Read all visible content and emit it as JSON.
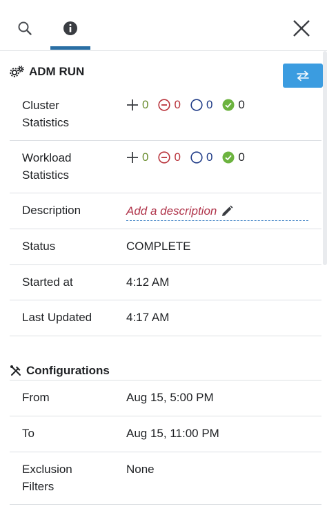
{
  "header": {
    "tabs": [
      {
        "name": "search",
        "icon": "search-icon",
        "active": false
      },
      {
        "name": "info",
        "icon": "info-icon",
        "active": true
      }
    ],
    "close_icon": "close-icon"
  },
  "adm_run": {
    "title": "ADM RUN",
    "icon": "gears-icon",
    "switch_icon": "swap-arrows-icon",
    "rows": {
      "cluster": {
        "label_line1": "Cluster",
        "label_line2": "Statistics",
        "added": "0",
        "removed": "0",
        "unchanged": "0",
        "approved": "0"
      },
      "workload": {
        "label_line1": "Workload",
        "label_line2": "Statistics",
        "added": "0",
        "removed": "0",
        "unchanged": "0",
        "approved": "0"
      },
      "description": {
        "label": "Description",
        "placeholder": "Add a description"
      },
      "status": {
        "label": "Status",
        "value": "COMPLETE"
      },
      "started_at": {
        "label": "Started at",
        "value": "4:12 AM"
      },
      "last_updated": {
        "label": "Last Updated",
        "value": "4:17 AM"
      }
    }
  },
  "configurations": {
    "title": "Configurations",
    "icon": "tools-icon",
    "rows": {
      "from": {
        "label": "From",
        "value": "Aug 15, 5:00 PM"
      },
      "to": {
        "label": "To",
        "value": "Aug 15, 11:00 PM"
      },
      "exclusion": {
        "label_line1": "Exclusion",
        "label_line2": "Filters",
        "value": "None"
      }
    }
  },
  "colors": {
    "accent": "#2a6fa4",
    "button": "#3b9ce0",
    "plus": "#6a8d2f",
    "minus": "#b9333b",
    "circle": "#1f3b87",
    "check": "#6cb33f",
    "link": "#b0344a"
  }
}
